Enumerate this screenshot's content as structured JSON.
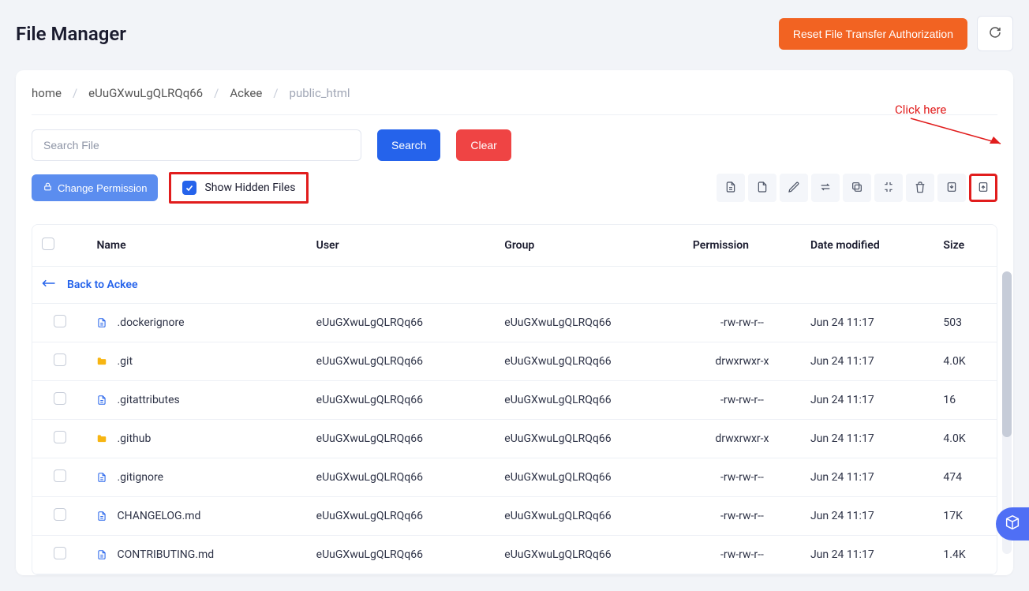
{
  "page_title": "File Manager",
  "header": {
    "reset_label": "Reset File Transfer Authorization"
  },
  "breadcrumb": {
    "items": [
      "home",
      "eUuGXwuLgQLRQq66",
      "Ackee",
      "public_html"
    ]
  },
  "search": {
    "placeholder": "Search File",
    "search_btn": "Search",
    "clear_btn": "Clear"
  },
  "actions": {
    "change_permission": "Change Permission",
    "show_hidden": "Show Hidden Files"
  },
  "annotation": {
    "text": "Click here"
  },
  "table": {
    "headers": {
      "name": "Name",
      "user": "User",
      "group": "Group",
      "permission": "Permission",
      "date": "Date modified",
      "size": "Size"
    },
    "back_label": "Back to Ackee",
    "rows": [
      {
        "type": "file",
        "name": ".dockerignore",
        "user": "eUuGXwuLgQLRQq66",
        "group": "eUuGXwuLgQLRQq66",
        "perm": "-rw-rw-r--",
        "date": "Jun 24 11:17",
        "size": "503"
      },
      {
        "type": "folder",
        "name": ".git",
        "user": "eUuGXwuLgQLRQq66",
        "group": "eUuGXwuLgQLRQq66",
        "perm": "drwxrwxr-x",
        "date": "Jun 24 11:17",
        "size": "4.0K"
      },
      {
        "type": "file",
        "name": ".gitattributes",
        "user": "eUuGXwuLgQLRQq66",
        "group": "eUuGXwuLgQLRQq66",
        "perm": "-rw-rw-r--",
        "date": "Jun 24 11:17",
        "size": "16"
      },
      {
        "type": "folder",
        "name": ".github",
        "user": "eUuGXwuLgQLRQq66",
        "group": "eUuGXwuLgQLRQq66",
        "perm": "drwxrwxr-x",
        "date": "Jun 24 11:17",
        "size": "4.0K"
      },
      {
        "type": "file",
        "name": ".gitignore",
        "user": "eUuGXwuLgQLRQq66",
        "group": "eUuGXwuLgQLRQq66",
        "perm": "-rw-rw-r--",
        "date": "Jun 24 11:17",
        "size": "474"
      },
      {
        "type": "file",
        "name": "CHANGELOG.md",
        "user": "eUuGXwuLgQLRQq66",
        "group": "eUuGXwuLgQLRQq66",
        "perm": "-rw-rw-r--",
        "date": "Jun 24 11:17",
        "size": "17K"
      },
      {
        "type": "file",
        "name": "CONTRIBUTING.md",
        "user": "eUuGXwuLgQLRQq66",
        "group": "eUuGXwuLgQLRQq66",
        "perm": "-rw-rw-r--",
        "date": "Jun 24 11:17",
        "size": "1.4K"
      }
    ]
  }
}
